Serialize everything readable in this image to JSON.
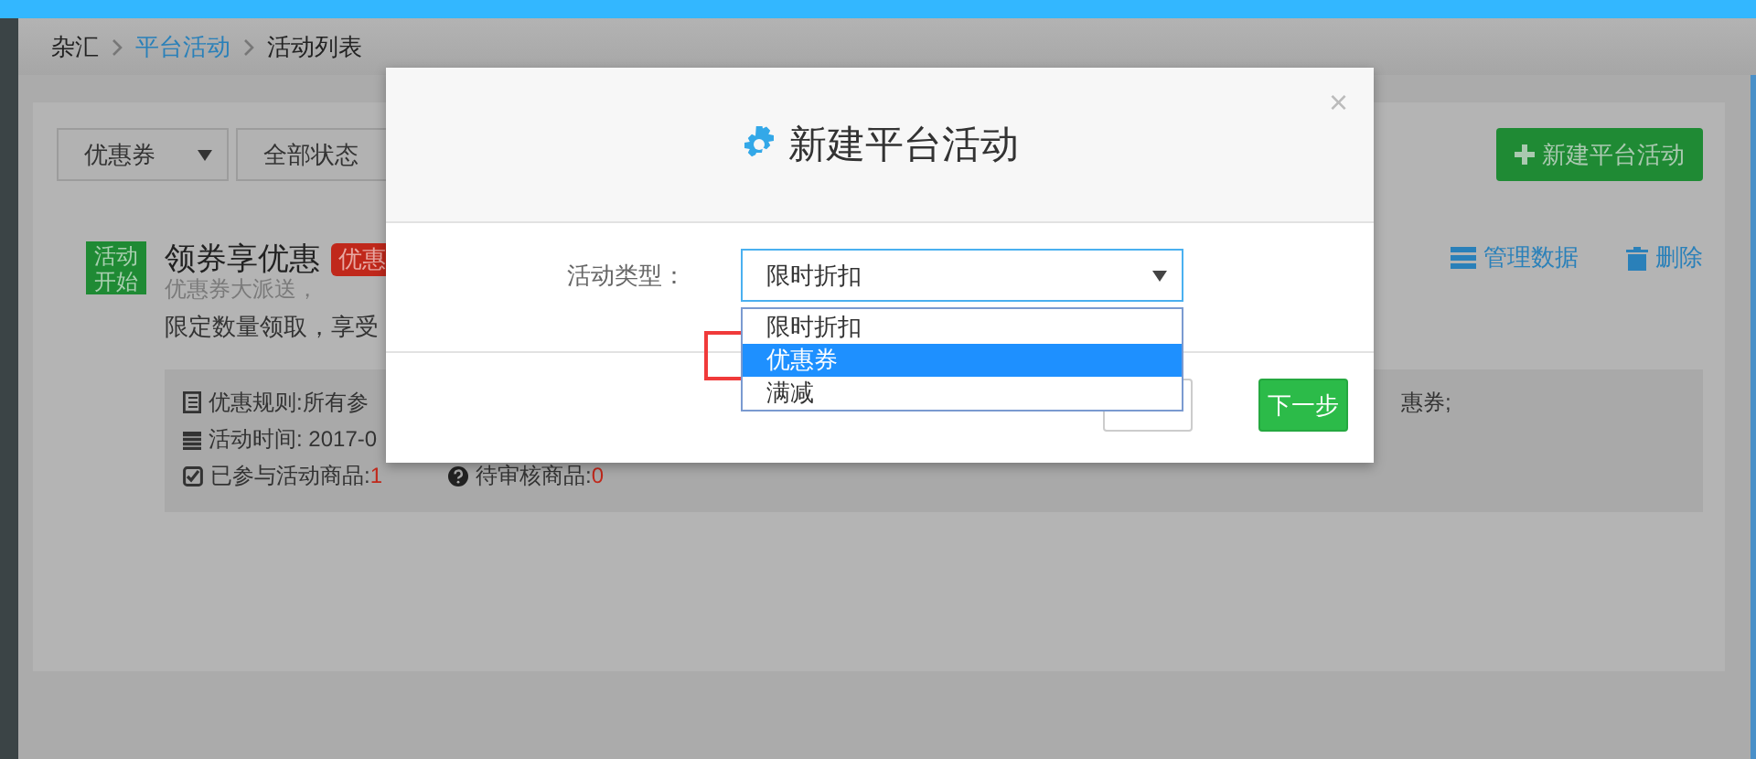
{
  "breadcrumb": [
    {
      "label": "杂汇",
      "link": false
    },
    {
      "label": "平台活动",
      "link": true
    },
    {
      "label": "活动列表",
      "link": false
    }
  ],
  "filters": [
    {
      "label": "优惠券",
      "caret": true
    },
    {
      "label": "全部状态",
      "caret": false
    }
  ],
  "new_button": "新建平台活动",
  "activity": {
    "status_tag": "活动开始",
    "title": "领券享优惠",
    "badge": "优惠",
    "subtitle": "优惠券大派送，",
    "description": "限定数量领取，享受",
    "actions": [
      {
        "label": "管理数据",
        "kind": "manage"
      },
      {
        "label": "删除",
        "kind": "delete"
      }
    ],
    "rules": {
      "rule_left": "优惠规则:所有参",
      "rule_right": "惠券;",
      "time": "活动时间: 2017-0",
      "joined_label": "已参与活动商品:",
      "joined_count": "1",
      "pending_label": "待审核商品:",
      "pending_count": "0"
    }
  },
  "modal": {
    "title": "新建平台活动",
    "close": "×",
    "field_label": "活动类型：",
    "select_value": "限时折扣",
    "options": [
      {
        "label": "限时折扣",
        "selected": false
      },
      {
        "label": "优惠券",
        "selected": true
      },
      {
        "label": "满减",
        "selected": false
      }
    ],
    "next_button": "下一步"
  }
}
